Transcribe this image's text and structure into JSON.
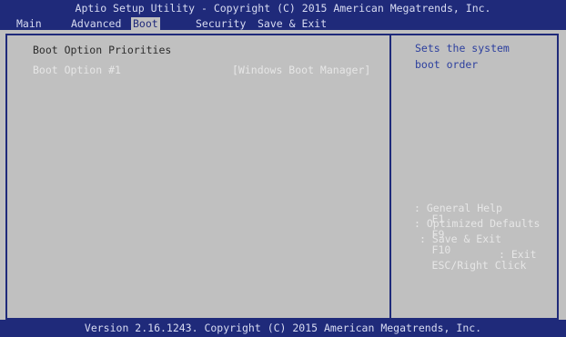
{
  "header": {
    "title": "Aptio Setup Utility - Copyright (C) 2015 American Megatrends, Inc.",
    "tabs": [
      {
        "label": "Main"
      },
      {
        "label": "Advanced"
      },
      {
        "label": "Boot"
      },
      {
        "label": "Security"
      },
      {
        "label": "Save & Exit"
      }
    ],
    "active_tab": "Boot"
  },
  "main": {
    "section_title": "Boot Option Priorities",
    "options": [
      {
        "label": "Boot Option #1",
        "value": "[Windows Boot Manager]"
      }
    ]
  },
  "help": {
    "lines": [
      "Sets the system",
      "boot order"
    ]
  },
  "keys": [
    {
      "key": "F1",
      "desc": ": General Help"
    },
    {
      "key": "F9",
      "desc": ": Optimized Defaults"
    },
    {
      "key": "F10",
      "desc": ": Save & Exit"
    },
    {
      "key": "ESC/Right Click",
      "desc": ": Exit"
    }
  ],
  "footer": {
    "text": "Version 2.16.1243. Copyright (C) 2015 American Megatrends, Inc."
  },
  "colors": {
    "header_bg": "#1f2a7a",
    "body_bg": "#c0c0c0",
    "help_text": "#2c3f9e",
    "highlight_text": "#e6e6e6"
  }
}
